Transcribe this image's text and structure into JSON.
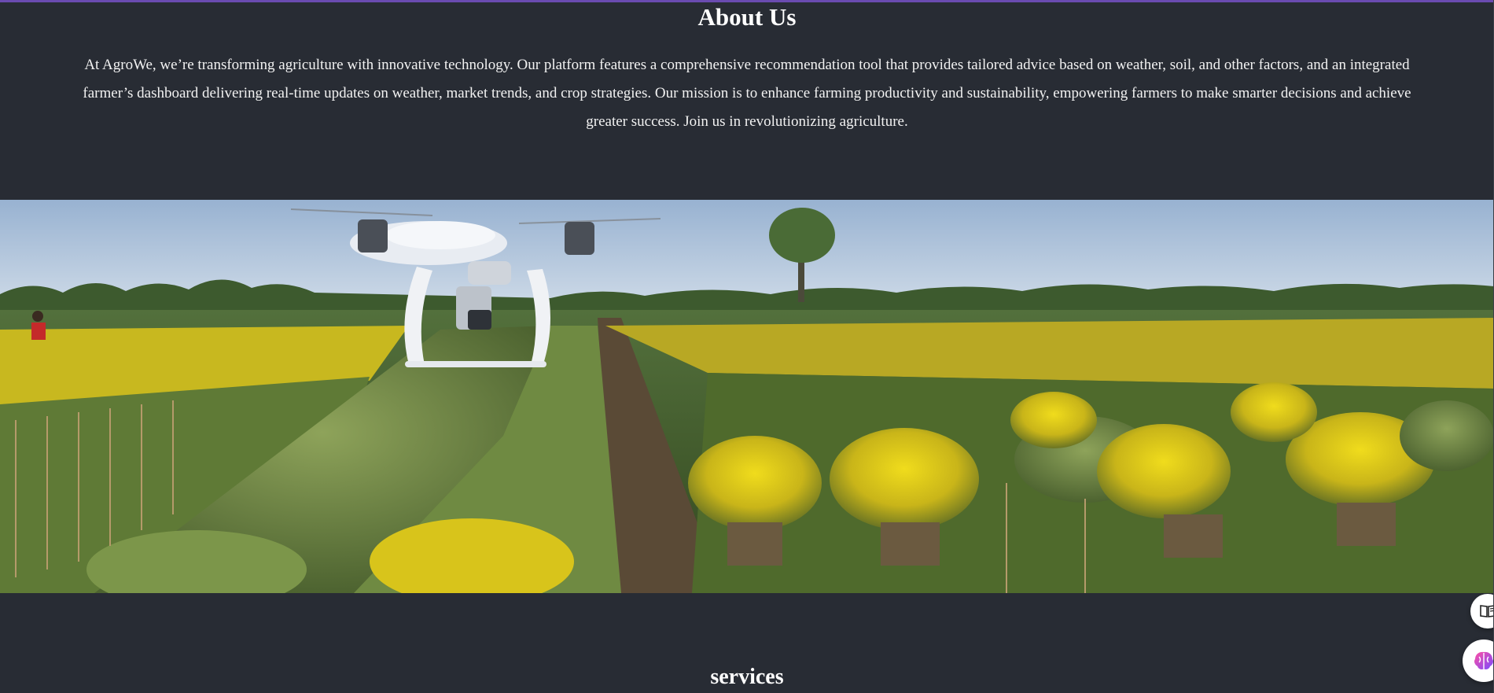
{
  "about": {
    "title": "About Us",
    "paragraph": "At AgroWe, we’re transforming agriculture with innovative technology. Our platform features a comprehensive recommendation tool that provides tailored advice based on weather, soil, and other factors, and an integrated farmer’s dashboard delivering real-time updates on weather, market trends, and crop strategies. Our mission is to enhance farming productivity and sustainability, empowering farmers to make smarter decisions and achieve greater success. Join us in revolutionizing agriculture."
  },
  "services": {
    "title": "services"
  },
  "floating_buttons": {
    "reader": {
      "icon": "book-reader-icon"
    },
    "assistant": {
      "icon": "brain-icon"
    }
  },
  "colors": {
    "background": "#282c34",
    "accent_bar": "#6a4bb0",
    "heading": "#ffffff",
    "text": "#f2f2f2",
    "flower_yellow": "#e8d21a"
  }
}
